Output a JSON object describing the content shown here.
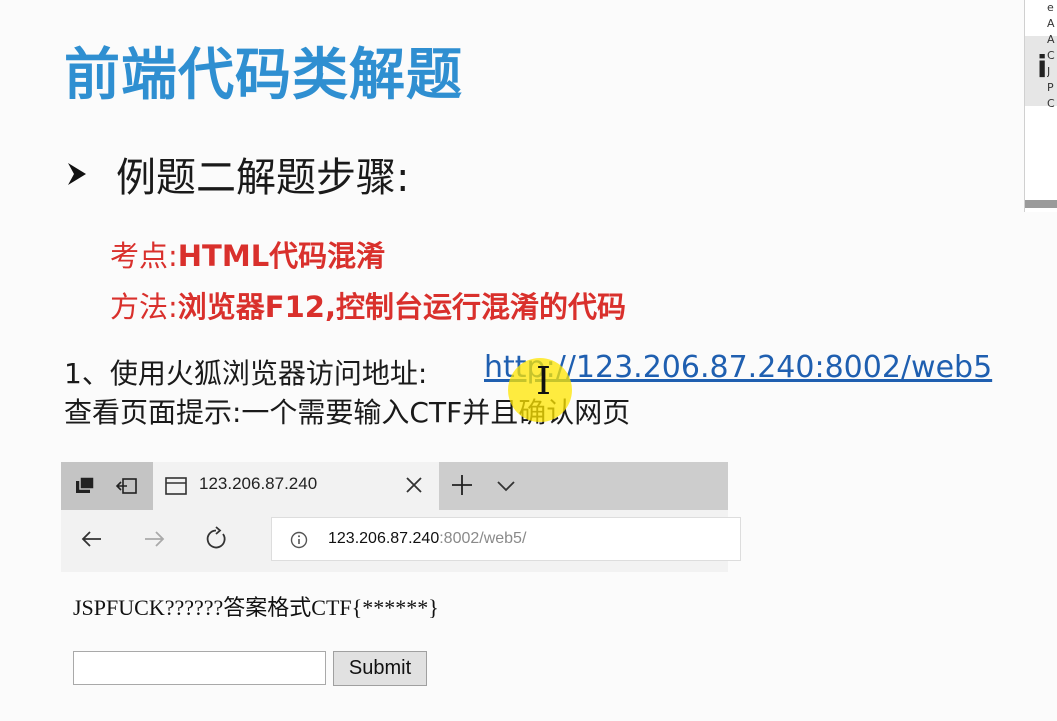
{
  "slide": {
    "title": "前端代码类解题",
    "bullet": "例题二解题步骤:",
    "point_label": "考点:",
    "point_value": "HTML代码混淆",
    "method_label": "方法:",
    "method_value": "浏览器F12,控制台运行混淆的代码",
    "step1_prefix": "1、使用火狐浏览器访问地址:",
    "step1_link": "http://123.206.87.240:8002/web5",
    "step1_line2": "查看页面提示:一个需要输入CTF并且确认网页"
  },
  "browser": {
    "tab_title": "123.206.87.240",
    "address_host": "123.206.87.240",
    "address_path": ":8002/web5/",
    "page_text": "JSPFUCK??????答案格式CTF{******}",
    "input_value": "",
    "submit_label": "Submit"
  },
  "side_panel": {
    "items": [
      "e",
      "A",
      "A",
      "C",
      "J",
      "P",
      "C"
    ]
  },
  "colors": {
    "title": "#2f8fd1",
    "red_text": "#d9302c",
    "link": "#1f5fb0",
    "highlight": "#ffe600"
  }
}
